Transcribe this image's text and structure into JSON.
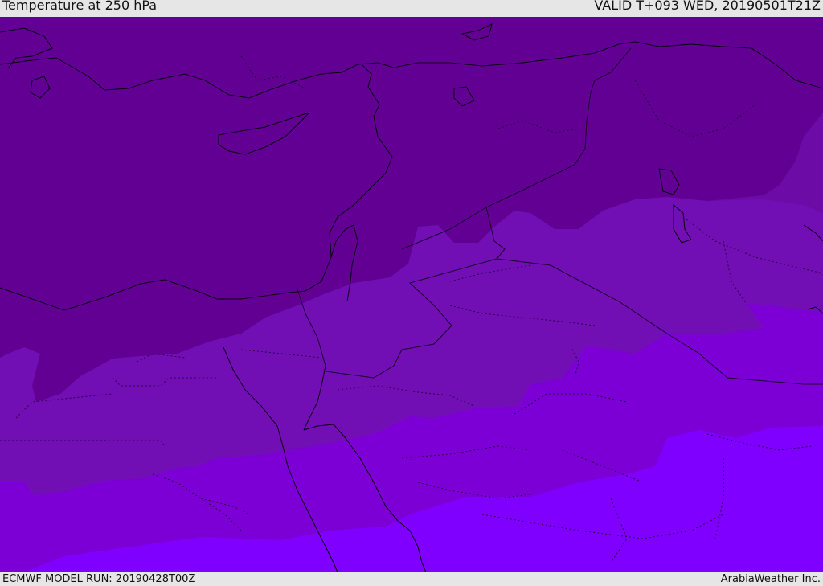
{
  "header": {
    "title": "Temperature at 250 hPa",
    "valid": "VALID T+093 WED, 20190501T21Z"
  },
  "footer": {
    "model_run": "ECMWF MODEL RUN: 20190428T00Z",
    "credit": "ArabiaWeather Inc."
  },
  "colors": {
    "band_coldest": "#630094",
    "band_cold": "#6c0ba6",
    "band_mid": "#720fb4",
    "band_warm": "#7c00d6",
    "band_warmest": "#7f00fe",
    "coastline": "#0a0014",
    "border": "#1a0030"
  }
}
